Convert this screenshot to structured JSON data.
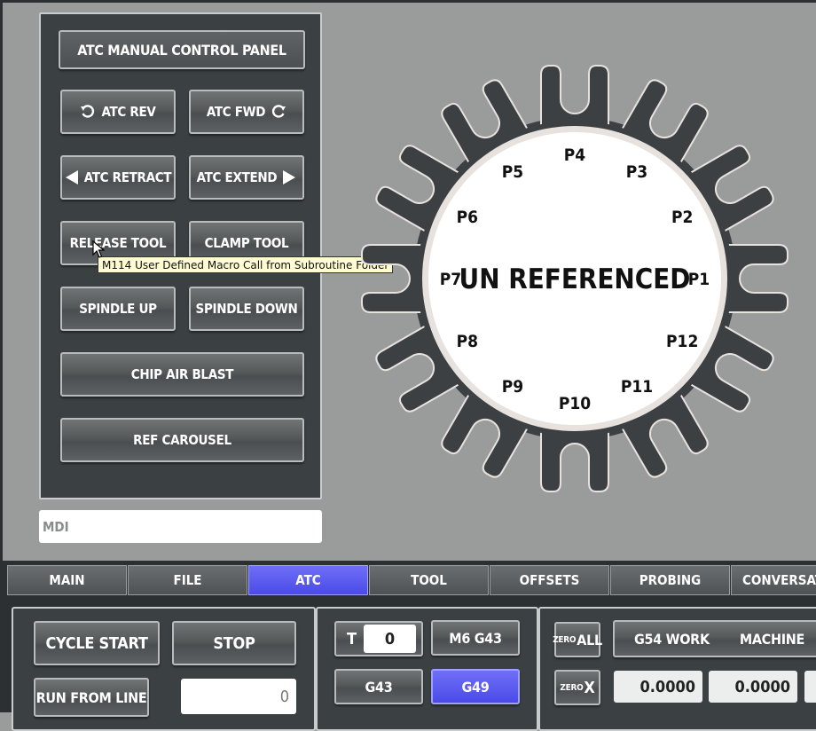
{
  "panel": {
    "title": "ATC MANUAL CONTROL PANEL",
    "atc_rev": "ATC REV",
    "atc_fwd": "ATC FWD",
    "atc_retract": "ATC RETRACT",
    "atc_extend": "ATC EXTEND",
    "release_tool": "RELEASE TOOL",
    "clamp_tool": "CLAMP TOOL",
    "spindle_up": "SPINDLE UP",
    "spindle_down": "SPINDLE DOWN",
    "chip_air_blast": "CHIP AIR BLAST",
    "ref_carousel": "REF CAROUSEL"
  },
  "tooltip": "M114 User Defined Macro Call from Subroutine Folder",
  "mdi": {
    "placeholder": "MDI"
  },
  "carousel": {
    "status": "UN REFERENCED",
    "pockets": [
      "P1",
      "P2",
      "P3",
      "P4",
      "P5",
      "P6",
      "P7",
      "P8",
      "P9",
      "P10",
      "P11",
      "P12"
    ],
    "colors": {
      "body": "#3c4043",
      "face": "#ffffff",
      "rim": "#e6e0dc"
    }
  },
  "tabs": [
    {
      "label": "MAIN",
      "active": false
    },
    {
      "label": "FILE",
      "active": false
    },
    {
      "label": "ATC",
      "active": true
    },
    {
      "label": "TOOL",
      "active": false
    },
    {
      "label": "OFFSETS",
      "active": false
    },
    {
      "label": "PROBING",
      "active": false
    },
    {
      "label": "CONVERSATIONAL",
      "active": false
    }
  ],
  "bottom": {
    "cycle_start": "CYCLE START",
    "stop": "STOP",
    "run_from_line": "RUN FROM LINE",
    "run_from_line_value": "0",
    "t_label": "T",
    "t_value": "0",
    "m6g43": "M6 G43",
    "g43": "G43",
    "g49": "G49",
    "zero_all_small": "ZERO",
    "zero_all_big": "ALL",
    "zero_x_small": "ZERO",
    "zero_x_big": "X",
    "g54_work": "G54 WORK",
    "machine": "MACHINE",
    "x_work": "0.0000",
    "x_machine": "0.0000"
  },
  "accent": "#5555ee"
}
